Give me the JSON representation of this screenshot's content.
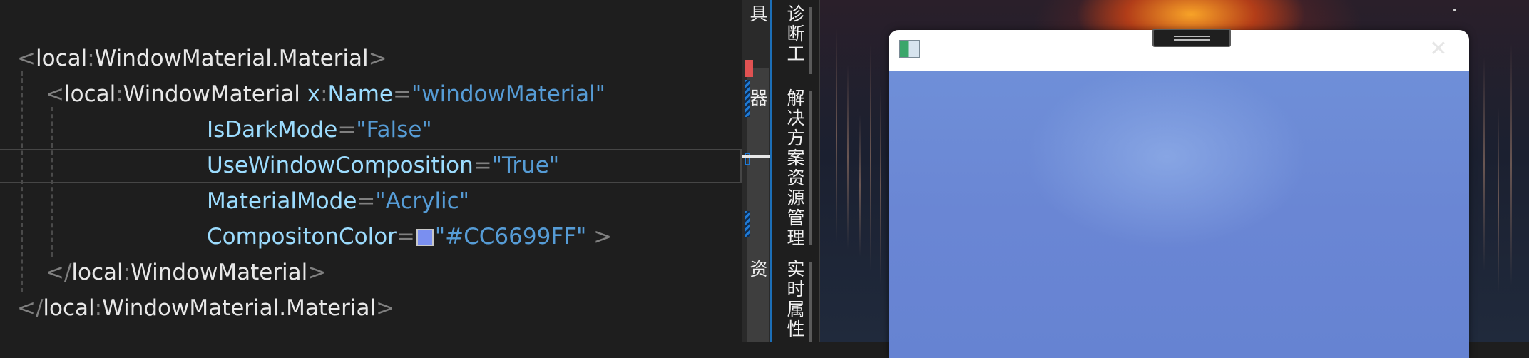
{
  "editor": {
    "lines": [
      {
        "prefix": "",
        "tokens": [
          {
            "t": "<",
            "c": "punct"
          },
          {
            "t": "local",
            "c": "tagname"
          },
          {
            "t": ":",
            "c": "punct"
          },
          {
            "t": "WindowMaterial.Material",
            "c": "tagname"
          },
          {
            "t": ">",
            "c": "punct"
          }
        ]
      },
      {
        "prefix": "",
        "tokens": [
          {
            "t": "<",
            "c": "punct"
          },
          {
            "t": "local",
            "c": "tagname"
          },
          {
            "t": ":",
            "c": "punct"
          },
          {
            "t": "WindowMaterial ",
            "c": "tagname"
          },
          {
            "t": "x",
            "c": "attr"
          },
          {
            "t": ":",
            "c": "punct"
          },
          {
            "t": "Name",
            "c": "attr"
          },
          {
            "t": "=",
            "c": "punct"
          },
          {
            "t": "\"windowMaterial\"",
            "c": "str"
          }
        ]
      },
      {
        "prefix": "",
        "tokens": [
          {
            "t": "IsDarkMode",
            "c": "attr"
          },
          {
            "t": "=",
            "c": "punct"
          },
          {
            "t": "\"False\"",
            "c": "str"
          }
        ]
      },
      {
        "prefix": "",
        "tokens": [
          {
            "t": "UseWindowComposition",
            "c": "attr"
          },
          {
            "t": "=",
            "c": "punct"
          },
          {
            "t": "\"True\"",
            "c": "str"
          }
        ]
      },
      {
        "prefix": "",
        "tokens": [
          {
            "t": "MaterialMode",
            "c": "attr"
          },
          {
            "t": "=",
            "c": "punct"
          },
          {
            "t": "\"Acrylic\"",
            "c": "str"
          }
        ]
      },
      {
        "prefix": "",
        "tokens": [
          {
            "t": "CompositonColor",
            "c": "attr"
          },
          {
            "t": "=",
            "c": "punct"
          },
          {
            "t": "",
            "c": "swatch"
          },
          {
            "t": "\"#CC6699FF\"",
            "c": "str"
          },
          {
            "t": " >",
            "c": "punct"
          }
        ]
      },
      {
        "prefix": "",
        "tokens": [
          {
            "t": "</",
            "c": "punct"
          },
          {
            "t": "local",
            "c": "tagname"
          },
          {
            "t": ":",
            "c": "punct"
          },
          {
            "t": "WindowMaterial",
            "c": "tagname"
          },
          {
            "t": ">",
            "c": "punct"
          }
        ]
      },
      {
        "prefix": "",
        "tokens": [
          {
            "t": "</",
            "c": "punct"
          },
          {
            "t": "local",
            "c": "tagname"
          },
          {
            "t": ":",
            "c": "punct"
          },
          {
            "t": "WindowMaterial.Material",
            "c": "tagname"
          },
          {
            "t": ">",
            "c": "punct"
          }
        ]
      }
    ],
    "swatch_color": "#CC6699FF"
  },
  "tool_tabs": [
    {
      "label": "诊断工具"
    },
    {
      "label": "解决方案资源管理器"
    },
    {
      "label": "实时属性资"
    }
  ],
  "demo_window": {
    "close_glyph": "✕",
    "composition_color": "#6699FF"
  },
  "colors": {
    "editor_bg": "#1e1e1e",
    "attribute": "#9cdcfe",
    "string": "#569cd6",
    "punctuation": "#808080",
    "error_marker": "#e05252",
    "change_marker": "#1f7ad6"
  }
}
